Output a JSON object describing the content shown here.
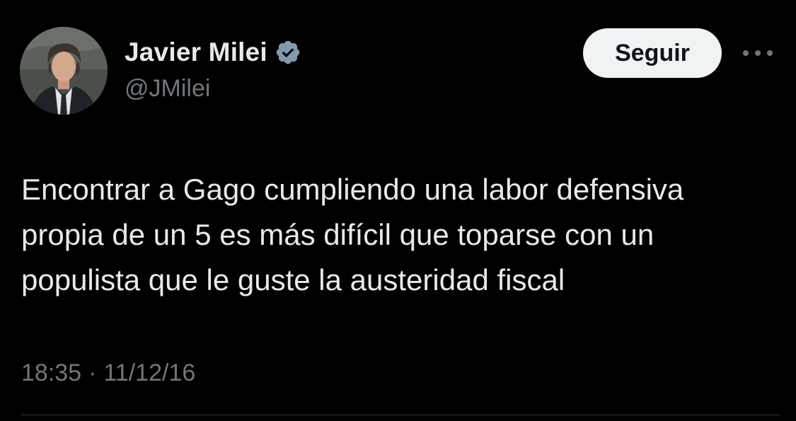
{
  "author": {
    "display_name": "Javier Milei",
    "handle": "@JMilei",
    "verified_icon": "verified-badge-icon"
  },
  "actions": {
    "follow_label": "Seguir",
    "more_icon": "more-options-icon"
  },
  "tweet": {
    "text": "Encontrar a Gago cumpliendo una labor defensiva\npropia de un 5 es más difícil que toparse con un\npopulista que le guste la austeridad fiscal",
    "time": "18:35",
    "separator": "·",
    "date": "11/12/16"
  },
  "colors": {
    "background": "#000000",
    "text": "#e7e9ea",
    "secondary_text": "#71767b",
    "follow_button_bg": "#eff3f4",
    "verified_badge": "#829aab"
  }
}
